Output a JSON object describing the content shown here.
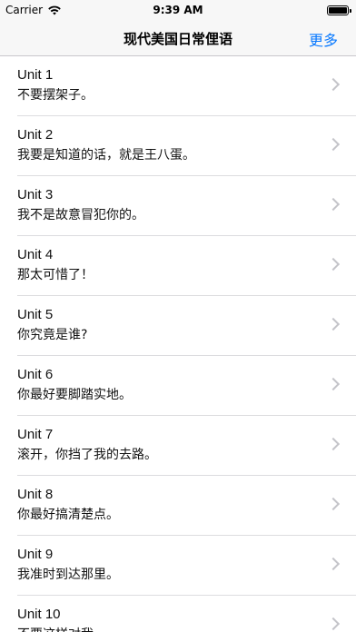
{
  "status_bar": {
    "carrier": "Carrier",
    "wifi_icon": "wifi-icon",
    "time": "9:39 AM",
    "battery_icon": "battery-icon",
    "battery_level": 1.0
  },
  "nav": {
    "title": "现代美国日常俚语",
    "more_label": "更多"
  },
  "list": {
    "items": [
      {
        "title": "Unit 1",
        "subtitle": "不要摆架子。"
      },
      {
        "title": "Unit 2",
        "subtitle": "我要是知道的话，就是王八蛋。"
      },
      {
        "title": "Unit 3",
        "subtitle": "我不是故意冒犯你的。"
      },
      {
        "title": "Unit 4",
        "subtitle": "那太可惜了！"
      },
      {
        "title": "Unit 5",
        "subtitle": "你究竟是谁?"
      },
      {
        "title": "Unit 6",
        "subtitle": "你最好要脚踏实地。"
      },
      {
        "title": "Unit 7",
        "subtitle": "滚开，你挡了我的去路。"
      },
      {
        "title": "Unit 8",
        "subtitle": "你最好搞清楚点。"
      },
      {
        "title": "Unit 9",
        "subtitle": "我准时到达那里。"
      },
      {
        "title": "Unit 10",
        "subtitle": "不要这样对我"
      }
    ],
    "chevron_icon": "chevron-right-icon"
  }
}
